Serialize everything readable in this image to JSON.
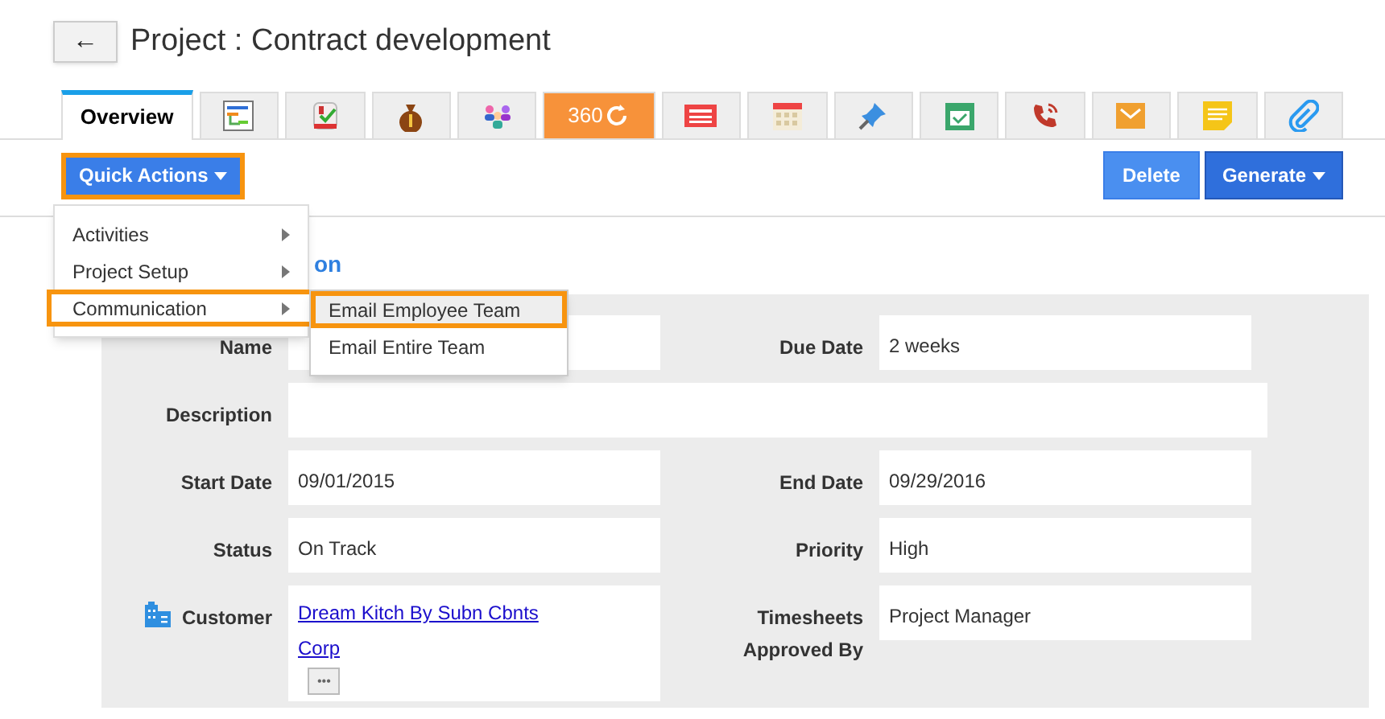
{
  "header": {
    "back_button": "←",
    "title": "Project : Contract development"
  },
  "tabs": [
    {
      "kind": "text",
      "label": "Overview",
      "selected": true
    },
    {
      "kind": "icon",
      "selected": false
    },
    {
      "kind": "icon",
      "selected": false
    },
    {
      "kind": "icon",
      "selected": false
    },
    {
      "kind": "icon",
      "selected": false
    },
    {
      "kind": "accent",
      "label": "360",
      "selected": false
    },
    {
      "kind": "icon",
      "selected": false
    },
    {
      "kind": "icon",
      "selected": false
    },
    {
      "kind": "icon",
      "selected": false
    },
    {
      "kind": "icon",
      "selected": false
    },
    {
      "kind": "icon",
      "selected": false
    },
    {
      "kind": "icon",
      "selected": false
    },
    {
      "kind": "icon",
      "selected": false
    },
    {
      "kind": "icon",
      "selected": false
    }
  ],
  "toolbar": {
    "quick_actions": "Quick Actions",
    "delete": "Delete",
    "generate": "Generate"
  },
  "menu": {
    "items": [
      {
        "label": "Activities",
        "selected": false
      },
      {
        "label": "Project Setup",
        "selected": false
      },
      {
        "label": "Communication",
        "selected": true
      }
    ],
    "submenu": [
      {
        "label": "Email Employee Team",
        "selected": true
      },
      {
        "label": "Email Entire Team",
        "selected": false
      }
    ]
  },
  "section_title": "on",
  "fields": [
    {
      "kind": "field",
      "label": "Name"
    },
    {
      "kind": "field",
      "label": "Due Date",
      "value": "2 weeks"
    },
    {
      "kind": "wide",
      "label": "Description"
    },
    {
      "kind": "field",
      "label": "Start Date",
      "value": "09/01/2015"
    },
    {
      "kind": "field",
      "label": "End Date",
      "value": "09/29/2016"
    },
    {
      "kind": "field",
      "label": "Status",
      "value": "On Track"
    },
    {
      "kind": "field",
      "label": "Priority",
      "value": "High"
    },
    {
      "kind": "link",
      "label": "Customer",
      "link": "Dream Kitch By Subn Cbnts Corp",
      "more": "•••"
    },
    {
      "kind": "field",
      "label": "Timesheets Approved By",
      "value": "Project Manager"
    }
  ]
}
